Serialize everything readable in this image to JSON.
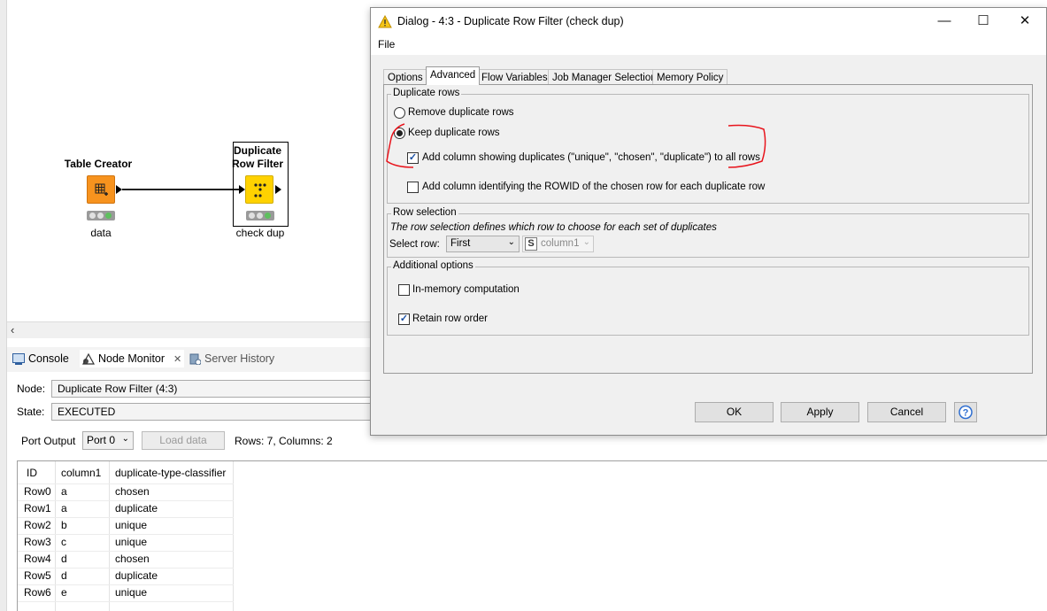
{
  "workflow": {
    "nodes": [
      {
        "title": "Table Creator",
        "subtitle": "data",
        "color": "#f7931e"
      },
      {
        "title_line1": "Duplicate",
        "title_line2": "Row Filter",
        "subtitle": "check dup",
        "color": "#ffd200"
      }
    ]
  },
  "panel": {
    "tabs": [
      {
        "label": "Console",
        "icon": "console-icon"
      },
      {
        "label": "Node Monitor",
        "icon": "node-monitor-icon"
      },
      {
        "label": "Server History",
        "icon": "server-history-icon"
      }
    ],
    "node_label": "Node:",
    "node_value": "Duplicate Row Filter  (4:3)",
    "state_label": "State:",
    "state_value": "EXECUTED",
    "port_output_label": "Port Output",
    "port_value": "Port 0",
    "load_data_label": "Load data",
    "rows_info": "Rows: 7, Columns: 2",
    "table": {
      "headers": [
        "ID",
        "column1",
        "duplicate-type-classifier"
      ],
      "rows": [
        [
          "Row0",
          "a",
          "chosen"
        ],
        [
          "Row1",
          "a",
          "duplicate"
        ],
        [
          "Row2",
          "b",
          "unique"
        ],
        [
          "Row3",
          "c",
          "unique"
        ],
        [
          "Row4",
          "d",
          "chosen"
        ],
        [
          "Row5",
          "d",
          "duplicate"
        ],
        [
          "Row6",
          "e",
          "unique"
        ]
      ]
    }
  },
  "dialog": {
    "title": "Dialog - 4:3 - Duplicate Row Filter (check dup)",
    "menu_file": "File",
    "tabs": [
      "Options",
      "Advanced",
      "Flow Variables",
      "Job Manager Selection",
      "Memory Policy"
    ],
    "active_tab": "Advanced",
    "duplicate_rows": {
      "title": "Duplicate rows",
      "remove_label": "Remove duplicate rows",
      "keep_label": "Keep duplicate rows",
      "selected": "keep",
      "add_column_label": "Add column showing duplicates (\"unique\", \"chosen\", \"duplicate\") to all rows",
      "add_column_checked": true,
      "add_rowid_label": "Add column identifying the ROWID of the chosen row for each duplicate row",
      "add_rowid_checked": false
    },
    "row_selection": {
      "title": "Row selection",
      "description": "The row selection defines which row to choose for each set of duplicates",
      "select_row_label": "Select row:",
      "select_row_value": "First",
      "column_type_badge": "S",
      "column_value": "column1"
    },
    "additional_options": {
      "title": "Additional options",
      "in_memory_label": "In-memory computation",
      "in_memory_checked": false,
      "retain_order_label": "Retain row order",
      "retain_order_checked": true
    },
    "buttons": {
      "ok": "OK",
      "apply": "Apply",
      "cancel": "Cancel"
    },
    "annotation_color": "#e8141c"
  }
}
